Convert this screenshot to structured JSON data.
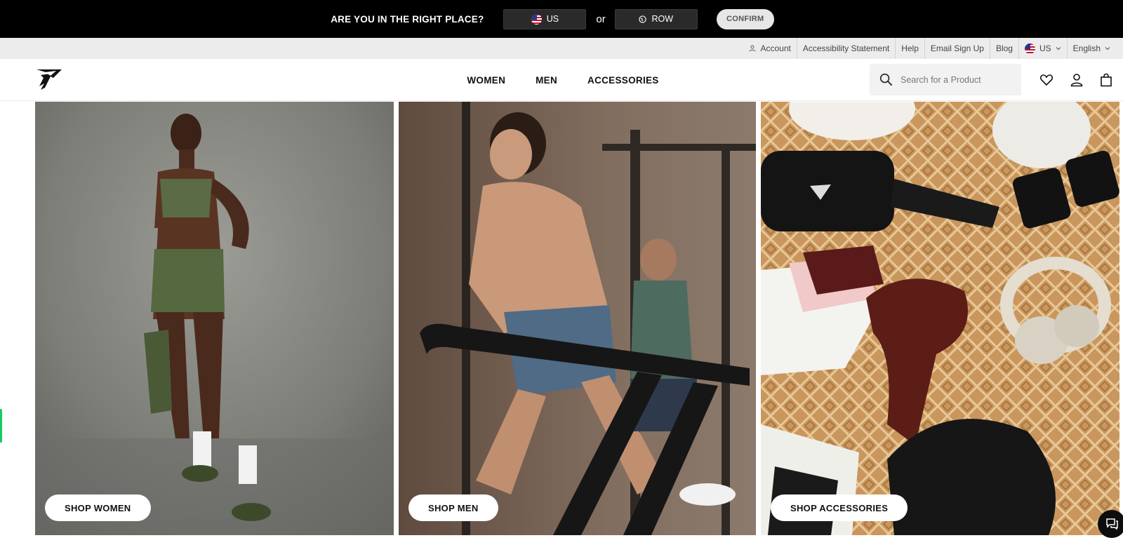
{
  "region_banner": {
    "question": "ARE YOU IN THE RIGHT PLACE?",
    "us_label": "US",
    "or_label": "or",
    "row_label": "ROW",
    "confirm_label": "CONFIRM"
  },
  "utility_bar": {
    "account": "Account",
    "accessibility": "Accessibility Statement",
    "help": "Help",
    "email_signup": "Email Sign Up",
    "blog": "Blog",
    "country": "US",
    "language": "English"
  },
  "header": {
    "nav": [
      "WOMEN",
      "MEN",
      "ACCESSORIES"
    ],
    "search_placeholder": "Search for a Product"
  },
  "tiles": [
    {
      "button": "SHOP WOMEN"
    },
    {
      "button": "SHOP MEN"
    },
    {
      "button": "SHOP ACCESSORIES"
    }
  ],
  "icons": {
    "logo": "gymshark-shark-logo",
    "search": "search-icon",
    "wishlist": "heart-icon",
    "account": "user-icon",
    "bag": "shopping-bag-icon",
    "chat": "chat-icon"
  },
  "colors": {
    "banner_bg": "#000000",
    "utility_bg": "#ececec",
    "accent_green": "#17c964"
  }
}
